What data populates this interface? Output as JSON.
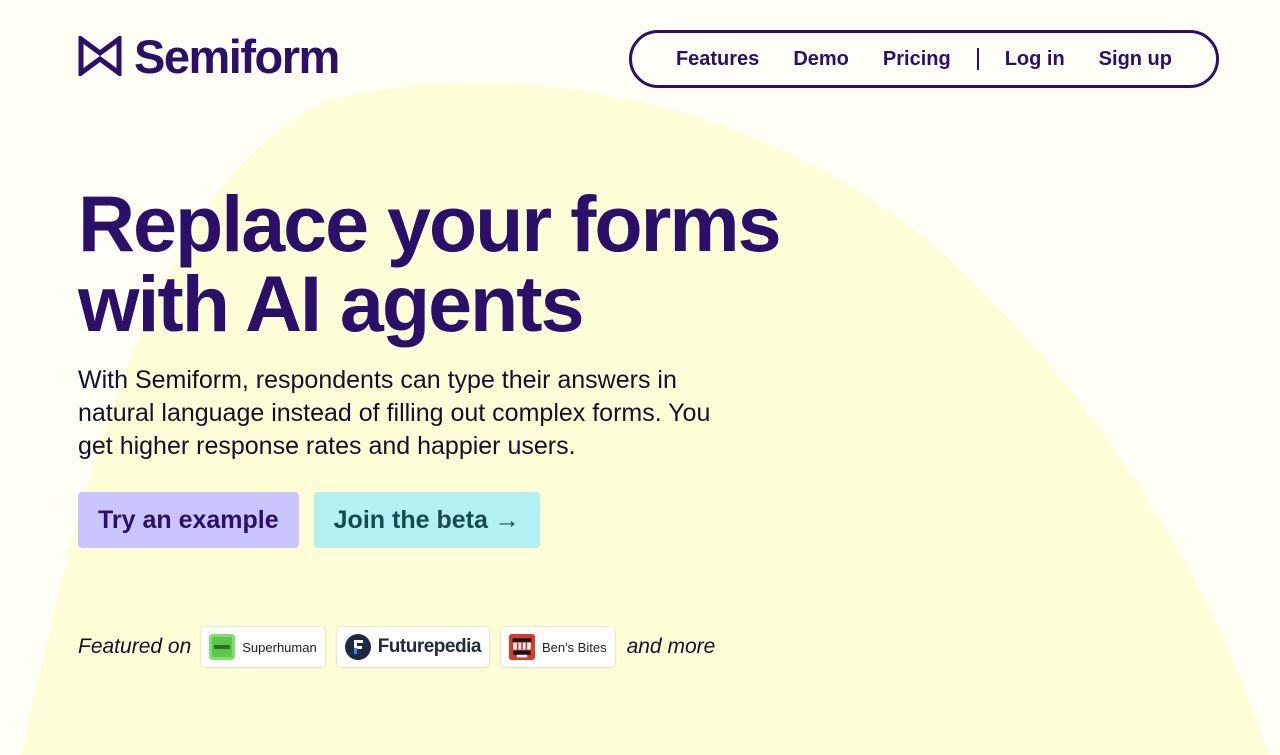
{
  "brand": {
    "name": "Semiform",
    "logo_icon": "bowtie-logo-icon"
  },
  "nav": {
    "features": "Features",
    "demo": "Demo",
    "pricing": "Pricing",
    "login": "Log in",
    "signup": "Sign up"
  },
  "hero": {
    "title_line1": "Replace your forms",
    "title_line2": "with AI agents",
    "subtitle": "With Semiform, respondents can type their answers in natural language instead of filling out complex forms. You get higher response rates and happier users.",
    "primary_cta": "Try an example",
    "secondary_cta": "Join the beta →"
  },
  "featured": {
    "label": "Featured on",
    "badges": [
      {
        "name": "Superhuman",
        "icon": "superhuman-icon"
      },
      {
        "name": "Futurepedia",
        "icon": "futurepedia-icon"
      },
      {
        "name": "Ben's Bites",
        "icon": "bens-bites-icon"
      }
    ],
    "more": "and more"
  },
  "colors": {
    "brand": "#2c0f6b",
    "background": "#fefef4",
    "blob": "#fdfed6",
    "primary_button": "#cac6fd",
    "secondary_button": "#b3f0f1"
  }
}
